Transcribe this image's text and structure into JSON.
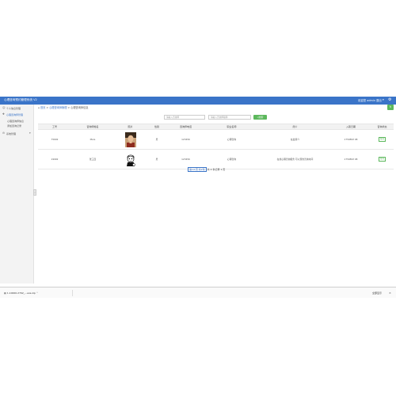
{
  "header": {
    "title": "心理咨询预约管理系统 V2",
    "user": "欢迎您 admin",
    "logout": "退出",
    "caret": "▾",
    "settings_icon": "gear-icon"
  },
  "sidebar": {
    "items": [
      {
        "label": "个人信息管理",
        "icon": "user-icon"
      },
      {
        "label": "心理咨询师管理",
        "icon": "doctor-icon"
      },
      {
        "label": "心理咨询师信息"
      },
      {
        "label": "添加咨询记录"
      },
      {
        "label": "系统管理",
        "icon": "gear-icon"
      }
    ],
    "collapse_arrow": "‹"
  },
  "breadcrumb": {
    "home": "首页",
    "sep": ">",
    "level1": "心理咨询师管理",
    "level2": "心理咨询师信息"
  },
  "toolbar": {
    "refresh_icon": "refresh-icon",
    "refresh_symbol": "↻",
    "name_placeholder": "请输入咨询师",
    "title_placeholder": "请输入咨询师职称",
    "search_label": "搜索"
  },
  "table": {
    "columns": [
      "工号",
      "咨询师姓名",
      "照片",
      "性别",
      "咨询师电话",
      "职业名称",
      "简介",
      "入职日期",
      "咨询状态"
    ],
    "rows": [
      {
        "id": "75692",
        "name": "Mars",
        "gender": "男",
        "phone": "123456",
        "job": "心理咨询",
        "intro": "在此简介",
        "date": "1750893 08",
        "status": "在岗"
      },
      {
        "id": "19992",
        "name": "张三四",
        "gender": "男",
        "phone": "123456",
        "job": "心理咨询",
        "intro": "在线心理咨询服务 可以预约咨询时间",
        "date": "1750893 08",
        "status": "在岗"
      }
    ]
  },
  "pager": {
    "page_info": "第1/1页 共2条",
    "summary": "共 2 条记录 1 页"
  },
  "downloads": {
    "file": "1.10000.2792_...exe.zip",
    "show_all": "全部显示",
    "close": "×"
  },
  "colors": {
    "header": "#3a74c8",
    "success": "#5cb85c",
    "sidebar": "#f3f3f3"
  }
}
